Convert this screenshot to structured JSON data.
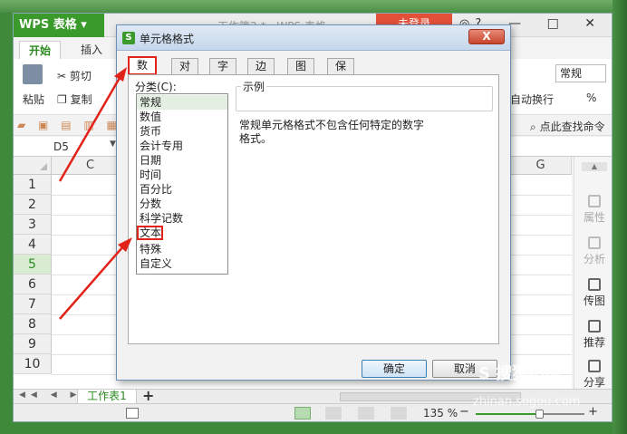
{
  "app": {
    "logo_text": "WPS 表格",
    "doc_title": "工作簿2 * - WPS 表格",
    "login_label": "未登录",
    "window_controls": "— □ ✕"
  },
  "ribbon": {
    "tabs": [
      "开始",
      "插入"
    ],
    "paste_label": "粘贴",
    "cut_label": "剪切",
    "copy_label": "复制",
    "wrap_label": "自动换行",
    "number_format": "常规",
    "percent_label": "%"
  },
  "quickbar": {
    "search_label": "点此查找命令"
  },
  "namebox": {
    "value": "D5"
  },
  "grid": {
    "columns": [
      "C",
      "G"
    ],
    "rows": [
      "1",
      "2",
      "3",
      "4",
      "5",
      "6",
      "7",
      "8",
      "9",
      "10"
    ],
    "selected_row": "5"
  },
  "sidepanel": {
    "items": [
      "属性",
      "分析",
      "传图",
      "推荐",
      "分享"
    ]
  },
  "sheetbar": {
    "sheet_name": "工作表1",
    "add_label": "+"
  },
  "statusbar": {
    "zoom_text": "135 %",
    "zoom_fraction": 0.58
  },
  "dialog": {
    "title": "单元格格式",
    "close_label": "X",
    "tabs": [
      "数字",
      "对齐",
      "字体",
      "边框",
      "图案",
      "保护"
    ],
    "active_tab": "数字",
    "category_label": "分类(C):",
    "categories": [
      "常规",
      "数值",
      "货币",
      "会计专用",
      "日期",
      "时间",
      "百分比",
      "分数",
      "科学记数",
      "文本",
      "特殊",
      "自定义"
    ],
    "selected_category": "常规",
    "highlighted_category": "文本",
    "sample_label": "示例",
    "description_line1": "常规单元格格式不包含任何特定的数字",
    "description_line2": "格式。",
    "ok_label": "确定",
    "cancel_label": "取消"
  },
  "watermark": {
    "logo": "S 搜狗指南",
    "url": "zhinan.sogou.com"
  },
  "colors": {
    "brand_green": "#3a9a2c",
    "annotation_red": "#e2231a",
    "login_red": "#e2503a"
  }
}
